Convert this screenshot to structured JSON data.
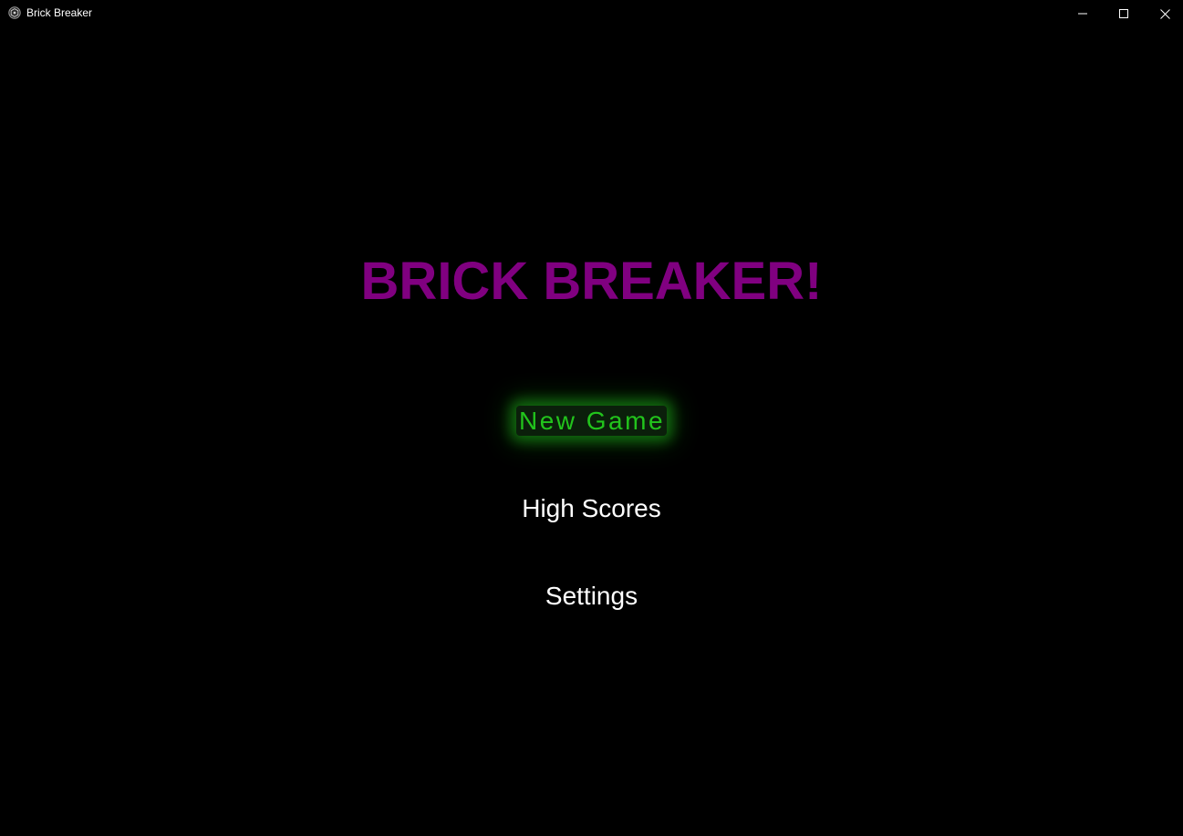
{
  "window": {
    "title": "Brick Breaker",
    "icon": "app-icon",
    "controls": {
      "minimize_icon": "minimize-icon",
      "maximize_icon": "maximize-icon",
      "close_icon": "close-icon"
    }
  },
  "game": {
    "title": "BRICK BREAKER!",
    "title_color": "#800080",
    "menu": {
      "new_game": "New Game",
      "high_scores": "High Scores",
      "settings": "Settings",
      "selected_color": "#22c41c",
      "default_color": "#ffffff"
    }
  }
}
